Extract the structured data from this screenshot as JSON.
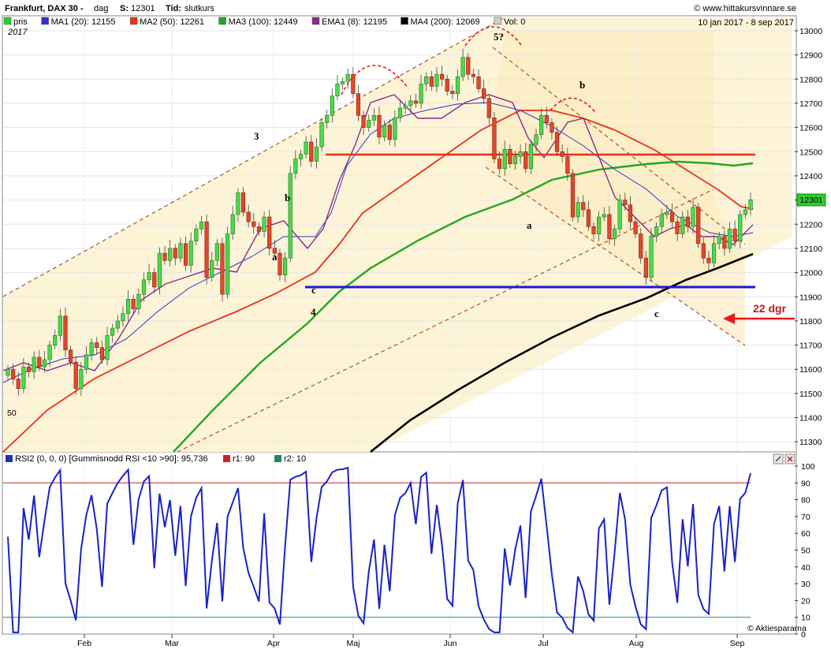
{
  "header": {
    "title": "Frankfurt, DAX 30 -",
    "period": "dag",
    "last_label": "S:",
    "last_value": "12301",
    "time_label": "Tid:",
    "time_value": "slutkurs",
    "brand": "© www.hittakursvinnare.se",
    "date_range": "10 jan 2017 - 8 sep 2017",
    "year_tag": "2017"
  },
  "legend": [
    {
      "label": "pris",
      "color": "#2ecc2e"
    },
    {
      "label": "MA1 (20): 12155",
      "color": "#3030c8"
    },
    {
      "label": "MA2 (50): 12261",
      "color": "#e8301c"
    },
    {
      "label": "MA3 (100): 12449",
      "color": "#22a822"
    },
    {
      "label": "EMA1 (8): 12195",
      "color": "#8a2a8a"
    },
    {
      "label": "MA4 (200): 12069",
      "color": "#000000"
    },
    {
      "label": "Vol: 0",
      "color": "#cccccc"
    }
  ],
  "price_badge": "12301",
  "rsi_header": {
    "label": "RSI2 (0, 0, 0) [Gummisnodd RSI <10 >90]: 95,736",
    "r1": "r1: 90",
    "r2": "r2: 10",
    "label_color": "#2233aa",
    "r1_color": "#cc2222",
    "r2_color": "#228866"
  },
  "watermark": "© Aktiespararna",
  "side_label": "50",
  "annotations": {
    "w3": "3",
    "w4": "4",
    "w5": "5?",
    "b1": "b",
    "a1": "a",
    "c1": "c",
    "a2": "a",
    "b2": "b",
    "c2": "c",
    "days": "22 dgr"
  },
  "chart_data": [
    {
      "type": "candlestick",
      "title": "Frankfurt, DAX 30 - dag",
      "x_tick_labels": [
        "Feb",
        "Mar",
        "Apr",
        "Maj",
        "Jun",
        "Jul",
        "Aug",
        "Sep"
      ],
      "y_tick_labels": [
        "13000",
        "12900",
        "12800",
        "12700",
        "12600",
        "12500",
        "12400",
        "12300",
        "12200",
        "12100",
        "12000",
        "11900",
        "11800",
        "11700",
        "11600",
        "11500",
        "11400",
        "11300"
      ],
      "ylim": [
        11260,
        13030
      ],
      "last_close": 12301,
      "closes": [
        11600,
        11560,
        11520,
        11610,
        11590,
        11650,
        11610,
        11640,
        11700,
        11740,
        11820,
        11680,
        11630,
        11520,
        11600,
        11660,
        11710,
        11690,
        11640,
        11740,
        11770,
        11800,
        11830,
        11890,
        11850,
        11910,
        11970,
        12000,
        11940,
        12080,
        12050,
        12100,
        12060,
        12120,
        12030,
        12130,
        12180,
        12210,
        11980,
        12050,
        12120,
        11910,
        12160,
        12240,
        12330,
        12250,
        12210,
        12190,
        12170,
        12230,
        12100,
        12080,
        11990,
        12060,
        12410,
        12470,
        12490,
        12540,
        12460,
        12520,
        12620,
        12650,
        12730,
        12780,
        12790,
        12820,
        12740,
        12650,
        12600,
        12630,
        12650,
        12560,
        12610,
        12550,
        12640,
        12680,
        12690,
        12710,
        12700,
        12780,
        12810,
        12770,
        12820,
        12800,
        12750,
        12740,
        12810,
        12890,
        12820,
        12810,
        12760,
        12720,
        12640,
        12470,
        12430,
        12510,
        12450,
        12480,
        12500,
        12430,
        12530,
        12570,
        12650,
        12620,
        12580,
        12500,
        12480,
        12410,
        12230,
        12290,
        12260,
        12190,
        12160,
        12230,
        12240,
        12140,
        12180,
        12300,
        12280,
        12210,
        12160,
        12060,
        11980,
        12150,
        12190,
        12240,
        12250,
        12210,
        12160,
        12230,
        12190,
        12270,
        12120,
        12060,
        12040,
        12120,
        12150,
        12100,
        12180,
        12130,
        12240,
        12260,
        12301
      ],
      "moving_averages": [
        {
          "name": "MA1 (20)",
          "last": 12155
        },
        {
          "name": "MA2 (50)",
          "last": 12261
        },
        {
          "name": "MA3 (100)",
          "last": 12449
        },
        {
          "name": "EMA1 (8)",
          "last": 12195
        },
        {
          "name": "MA4 (200)",
          "last": 12069
        }
      ],
      "horizontal_lines": [
        {
          "value": 12490,
          "color": "#e8301c"
        },
        {
          "value": 11935,
          "color": "#1a1adc"
        }
      ]
    },
    {
      "type": "line",
      "title": "RSI2",
      "y_tick_labels": [
        "100",
        "90",
        "80",
        "70",
        "60",
        "50",
        "40",
        "30",
        "20",
        "10",
        "0"
      ],
      "ylim": [
        0,
        100
      ],
      "reference_lines": [
        90,
        10
      ],
      "last_value": 95.736
    }
  ]
}
